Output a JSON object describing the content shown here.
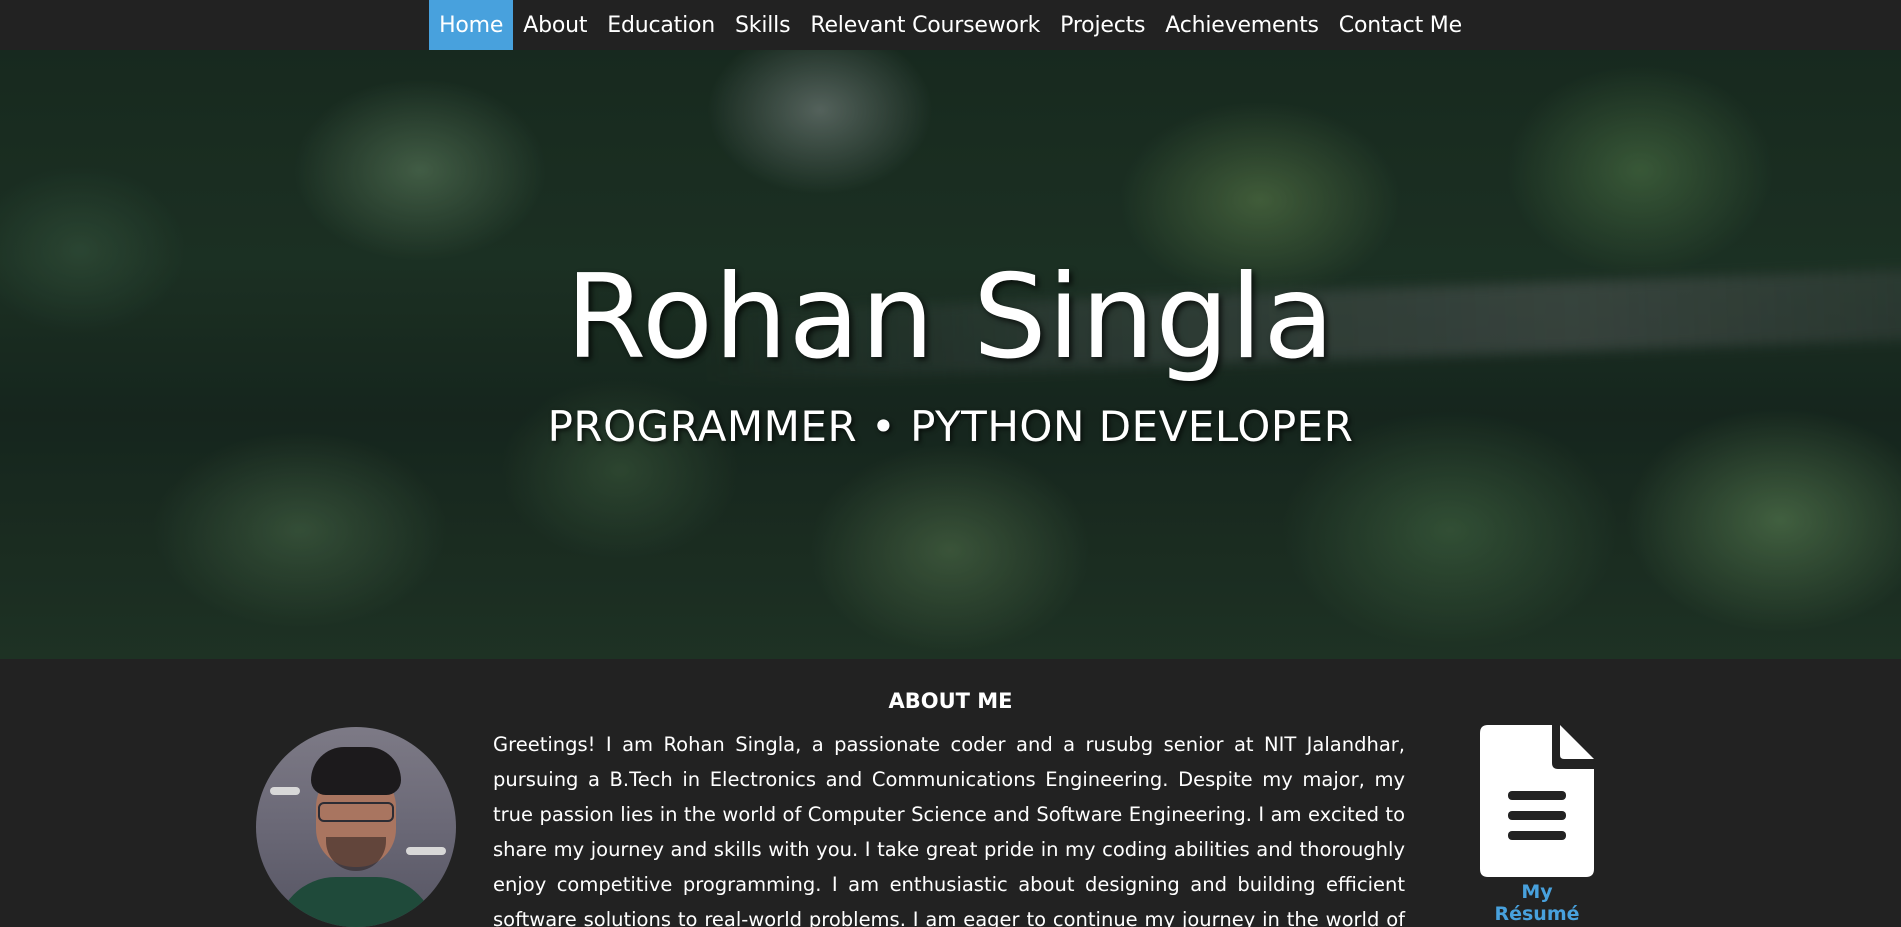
{
  "nav": {
    "items": [
      {
        "label": "Home",
        "active": true
      },
      {
        "label": "About"
      },
      {
        "label": "Education"
      },
      {
        "label": "Skills"
      },
      {
        "label": "Relevant Coursework"
      },
      {
        "label": "Projects"
      },
      {
        "label": "Achievements"
      },
      {
        "label": "Contact Me"
      }
    ]
  },
  "hero": {
    "name": "Rohan Singla",
    "tagline": "PROGRAMMER • PYTHON DEVELOPER"
  },
  "about": {
    "heading": "ABOUT ME",
    "text": "Greetings! I am Rohan Singla, a passionate coder and a rusubg senior at NIT Jalandhar, pursuing a B.Tech in Electronics and Communications Engineering. Despite my major, my true passion lies in the world of Computer Science and Software Engineering. I am excited to share my journey and skills with you. I take great pride in my coding abilities and thoroughly enjoy competitive programming. I am enthusiastic about designing and building efficient software solutions to real-world problems. I am eager to continue my journey in the world of Computer Science and",
    "resume_label": "My Résumé"
  },
  "colors": {
    "accent": "#48a1dd",
    "background": "#222222",
    "text": "#ffffff"
  },
  "icons": {
    "resume": "file-document-icon"
  }
}
